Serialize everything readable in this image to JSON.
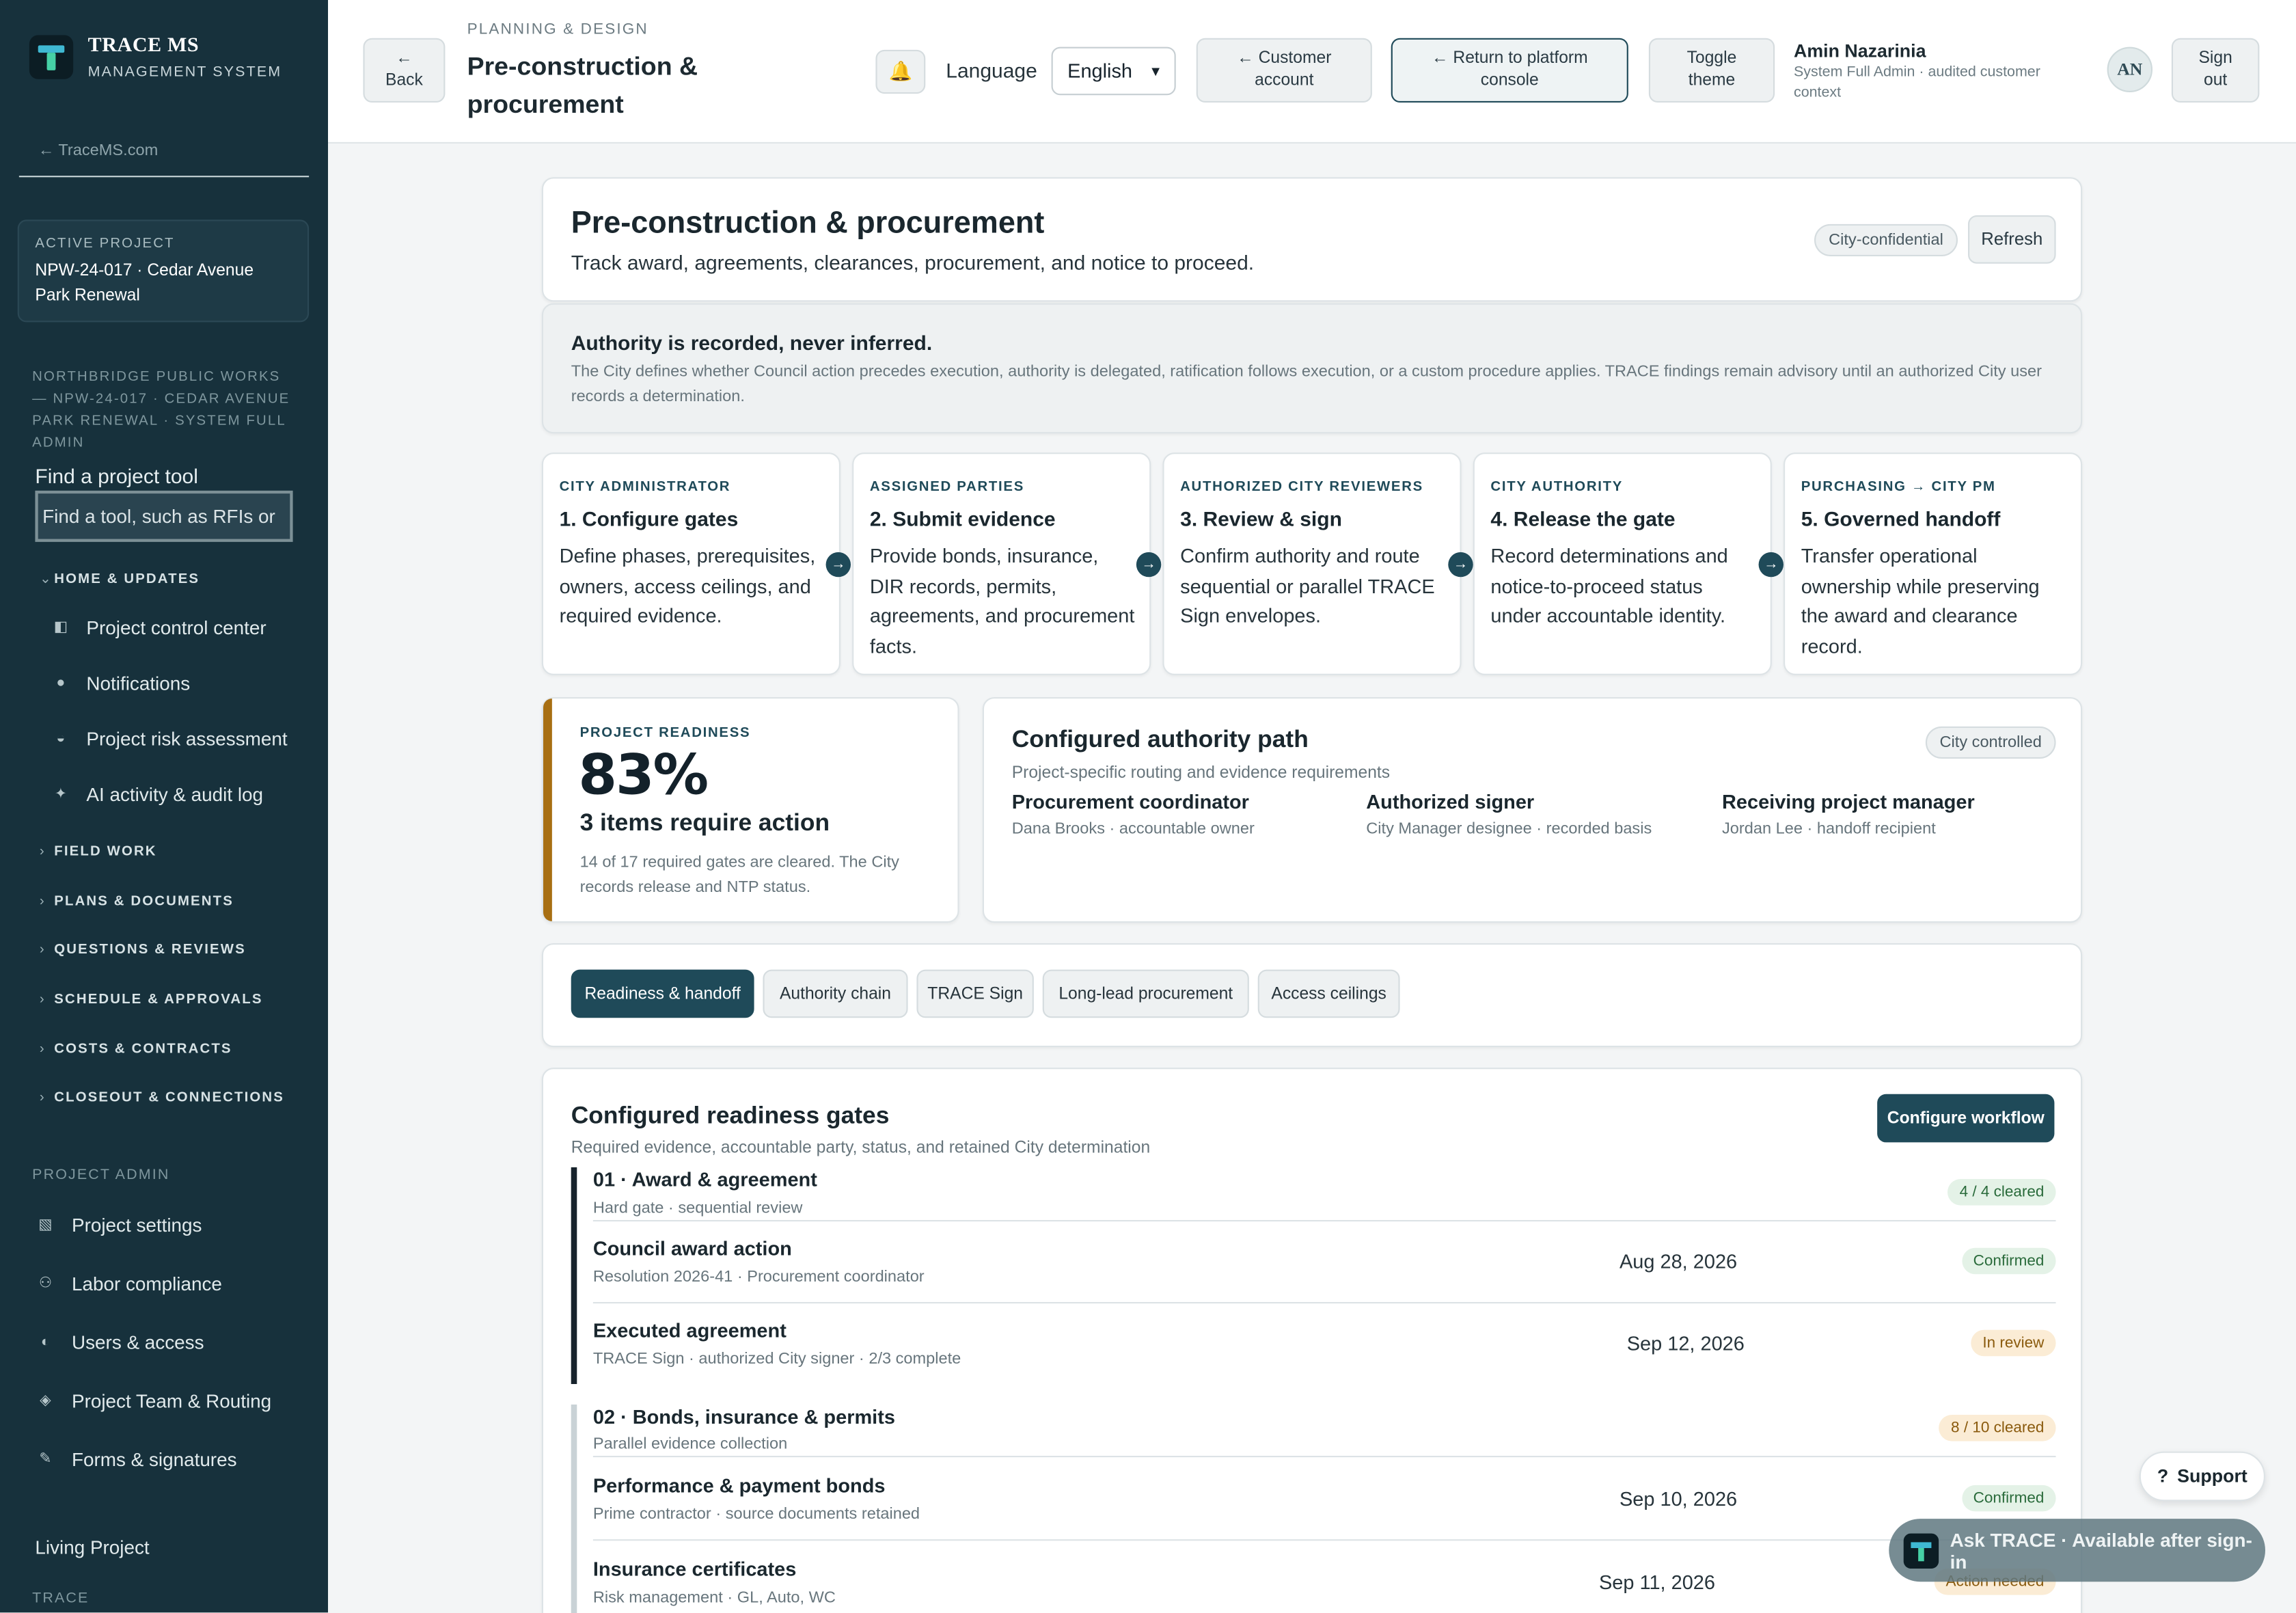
{
  "brand": {
    "title": "TRACE MS",
    "subtitle": "MANAGEMENT SYSTEM"
  },
  "sidebar": {
    "back_link": "← TraceMS.com",
    "active_project_label": "ACTIVE PROJECT",
    "active_project_value": "NPW-24-017 · Cedar Avenue Park Renewal",
    "context": "NORTHBRIDGE PUBLIC WORKS — NPW-24-017 · CEDAR AVENUE PARK RENEWAL · SYSTEM FULL ADMIN",
    "find_label": "Find a project tool",
    "find_placeholder": "Find a tool, such as RFIs or",
    "home_group": "HOME & UPDATES",
    "home_items": [
      {
        "label": "Project control center",
        "icon": "panel-icon"
      },
      {
        "label": "Notifications",
        "icon": "bell-icon"
      },
      {
        "label": "Project risk assessment",
        "icon": "gauge-icon"
      },
      {
        "label": "AI activity & audit log",
        "icon": "sparkle-icon"
      }
    ],
    "groups": [
      "FIELD WORK",
      "PLANS & DOCUMENTS",
      "QUESTIONS & REVIEWS",
      "SCHEDULE & APPROVALS",
      "COSTS & CONTRACTS",
      "CLOSEOUT & CONNECTIONS"
    ],
    "admin_label": "PROJECT ADMIN",
    "admin_items": [
      {
        "label": "Project settings",
        "icon": "settings-icon"
      },
      {
        "label": "Labor compliance",
        "icon": "people-icon"
      },
      {
        "label": "Users & access",
        "icon": "shield-icon"
      },
      {
        "label": "Project Team & Routing",
        "icon": "route-icon"
      },
      {
        "label": "Forms & signatures",
        "icon": "pen-icon"
      }
    ],
    "living_project": "Living Project",
    "trace_label": "TRACE"
  },
  "topbar": {
    "back_arrow": "←",
    "back_label": "Back",
    "breadcrumb": "PLANNING & DESIGN",
    "title": "Pre-construction & procurement",
    "language_label": "Language",
    "language_value": "English",
    "customer_account": "← Customer account",
    "return_console": "← Return to platform console",
    "toggle_theme": "Toggle theme",
    "user_name": "Amin Nazarinia",
    "user_role": "System Full Admin · audited customer context",
    "avatar": "AN",
    "sign_out": "Sign out"
  },
  "hero": {
    "title": "Pre-construction & procurement",
    "subtitle": "Track award, agreements, clearances, procurement, and notice to proceed.",
    "tag": "City-confidential",
    "refresh": "Refresh"
  },
  "authority_note": {
    "title": "Authority is recorded, never inferred.",
    "text": "The City defines whether Council action precedes execution, authority is delegated, ratification follows execution, or a custom procedure applies. TRACE findings remain advisory until an authorized City user records a determination."
  },
  "steps": [
    {
      "role": "CITY ADMINISTRATOR",
      "title": "1. Configure gates",
      "desc": "Define phases, prerequisites, owners, access ceilings, and required evidence."
    },
    {
      "role": "ASSIGNED PARTIES",
      "title": "2. Submit evidence",
      "desc": "Provide bonds, insurance, DIR records, permits, agreements, and procurement facts."
    },
    {
      "role": "AUTHORIZED CITY REVIEWERS",
      "title": "3. Review & sign",
      "desc": "Confirm authority and route sequential or parallel TRACE Sign envelopes."
    },
    {
      "role": "CITY AUTHORITY",
      "title": "4. Release the gate",
      "desc": "Record determinations and notice-to-proceed status under accountable identity."
    },
    {
      "role": "PURCHASING → CITY PM",
      "title": "5. Governed handoff",
      "desc": "Transfer operational ownership while preserving the award and clearance record."
    }
  ],
  "readiness": {
    "label": "PROJECT READINESS",
    "percent": "83%",
    "items": "3 items require action",
    "note": "14 of 17 required gates are cleared. The City records release and NTP status."
  },
  "authority_path": {
    "title": "Configured authority path",
    "subtitle": "Project-specific routing and evidence requirements",
    "tag": "City controlled",
    "roles": [
      {
        "role": "Procurement coordinator",
        "detail": "Dana Brooks · accountable owner"
      },
      {
        "role": "Authorized signer",
        "detail": "City Manager designee · recorded basis"
      },
      {
        "role": "Receiving project manager",
        "detail": "Jordan Lee · handoff recipient"
      }
    ]
  },
  "tabs": [
    "Readiness & handoff",
    "Authority chain",
    "TRACE Sign",
    "Long-lead procurement",
    "Access ceilings"
  ],
  "gates": {
    "title": "Configured readiness gates",
    "subtitle": "Required evidence, accountable party, status, and retained City determination",
    "configure": "Configure workflow",
    "sections": [
      {
        "title": "01 · Award & agreement",
        "sub": "Hard gate · sequential review",
        "count": "4 / 4 cleared",
        "rows": [
          {
            "title": "Council award action",
            "sub": "Resolution 2026-41 · Procurement coordinator",
            "date": "Aug 28, 2026",
            "status": "Confirmed"
          },
          {
            "title": "Executed agreement",
            "sub": "TRACE Sign · authorized City signer · 2/3 complete",
            "date": "Sep 12, 2026",
            "status": "In review"
          }
        ]
      },
      {
        "title": "02 · Bonds, insurance & permits",
        "sub": "Parallel evidence collection",
        "count": "8 / 10 cleared",
        "rows": [
          {
            "title": "Performance & payment bonds",
            "sub": "Prime contractor · source documents retained",
            "date": "Sep 10, 2026",
            "status": "Confirmed"
          },
          {
            "title": "Insurance certificates",
            "sub": "Risk management · GL, Auto, WC",
            "date": "Sep 11, 2026",
            "status": "Action needed"
          }
        ]
      }
    ]
  },
  "support": {
    "icon": "?",
    "label": "Support"
  },
  "ask_trace": "Ask TRACE · Available after sign-in",
  "colors": {
    "sidebar": "#17313c",
    "accent": "#1f4a59",
    "readiness_bar": "#a86f12"
  }
}
